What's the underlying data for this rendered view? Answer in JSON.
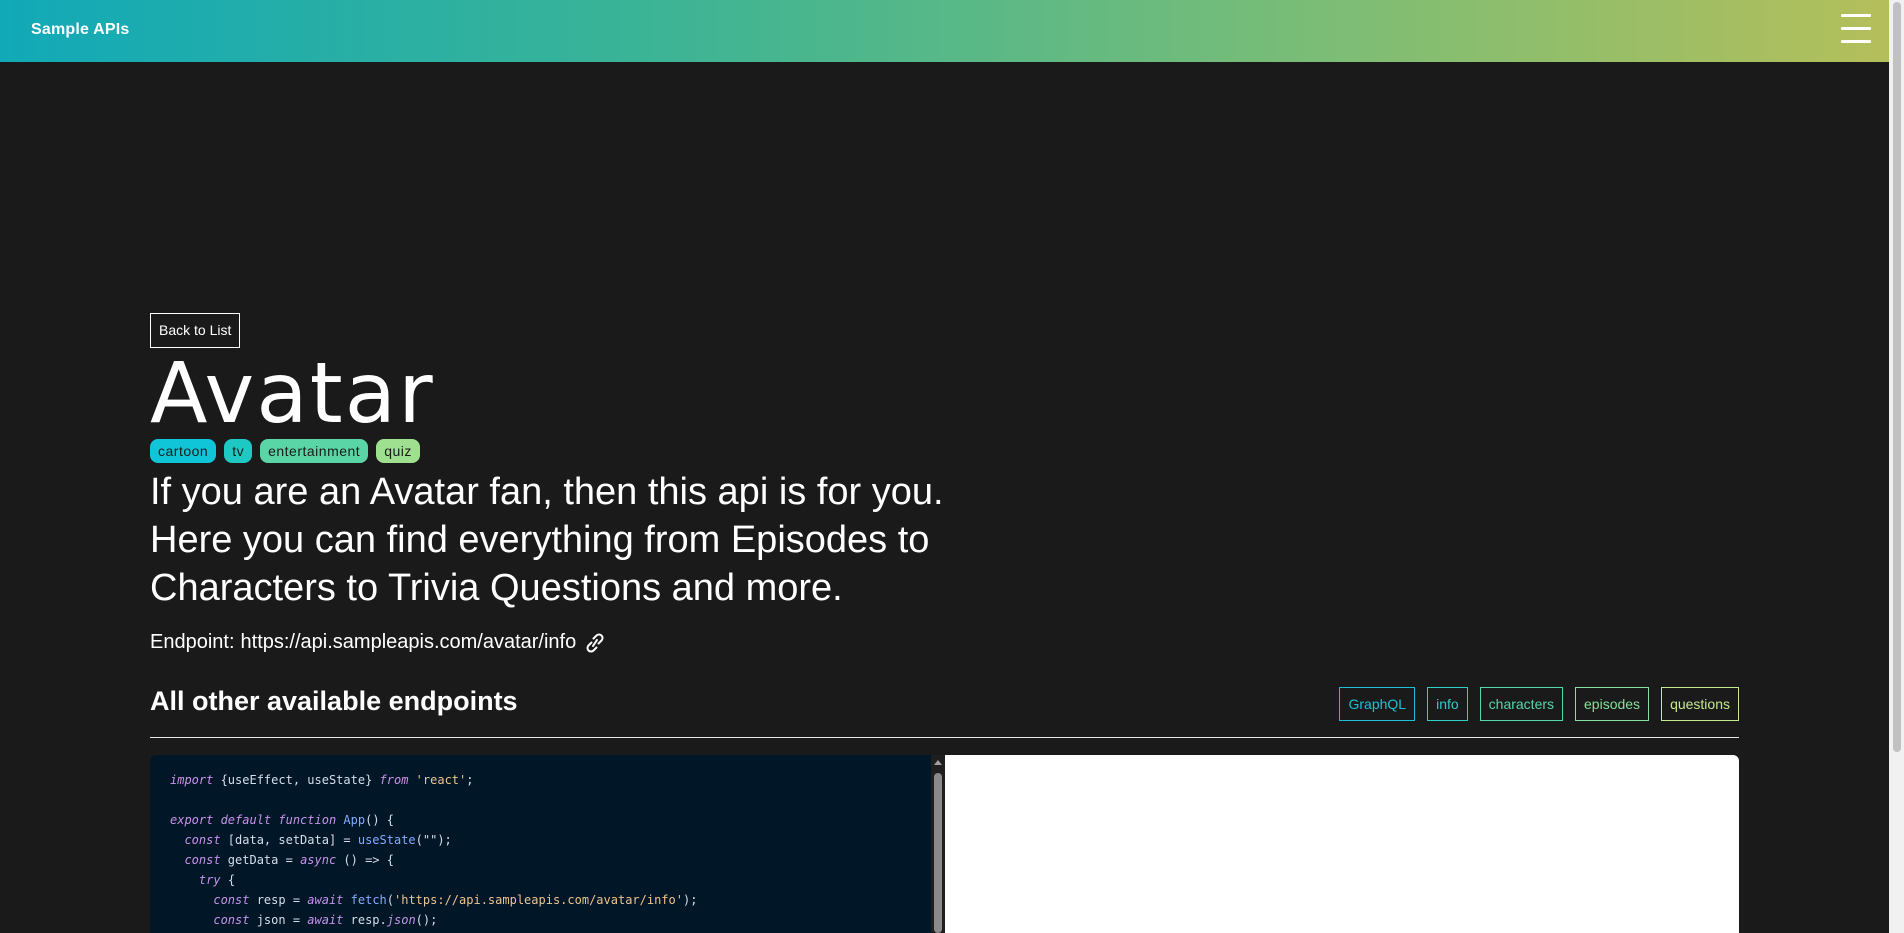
{
  "nav": {
    "brand": "Sample APIs",
    "menu_icon": "hamburger-menu-icon"
  },
  "back_button": "Back to List",
  "title": "Avatar",
  "tags": [
    {
      "label": "cartoon",
      "color": "#11c5d9"
    },
    {
      "label": "tv",
      "color": "#1fc9c3"
    },
    {
      "label": "entertainment",
      "color": "#5ad6a6"
    },
    {
      "label": "quiz",
      "color": "#9ee08f"
    }
  ],
  "description": "If you are an Avatar fan, then this api is for you. Here you can find everything from Episodes to Characters to Trivia Questions and more.",
  "endpoint": {
    "label": "Endpoint:",
    "url": "https://api.sampleapis.com/avatar/info",
    "icon": "link-icon"
  },
  "section_title": "All other available endpoints",
  "endpoint_links": [
    {
      "label": "GraphQL",
      "color": "#1ec0d6"
    },
    {
      "label": "info",
      "color": "#2fcfc8"
    },
    {
      "label": "characters",
      "color": "#52d8ab"
    },
    {
      "label": "episodes",
      "color": "#83e19b"
    },
    {
      "label": "questions",
      "color": "#c5ea8a"
    }
  ],
  "code": {
    "line1_kw_import": "import",
    "line1_a": " {useEffect, useState} ",
    "line1_kw_from": "from",
    "line1_str": "'react'",
    "line1_end": ";",
    "line3_kw": "export default function",
    "line3_fn": "App",
    "line3_end": "() {",
    "line4_kw": "const",
    "line4_a": " [data, setData] = ",
    "line4_fn": "useState",
    "line4_end": "(\"\");",
    "line5_kw": "const",
    "line5_a": " getData = ",
    "line5_kw2": "async",
    "line5_end": " () => {",
    "line6_kw": "try",
    "line6_end": " {",
    "line7_kw": "const",
    "line7_a": " resp = ",
    "line7_kw2": "await",
    "line7_fn": "fetch",
    "line7_str": "'https://api.sampleapis.com/avatar/info'",
    "line7_end": ");",
    "line8_kw": "const",
    "line8_a": " json = ",
    "line8_kw2": "await",
    "line8_b": " resp.",
    "line8_fn": "json",
    "line8_end": "();"
  },
  "colors": {
    "background": "#1a1a1a",
    "code_background": "#011627",
    "nav_gradient_start": "#11a9b8",
    "nav_gradient_end": "#b4bf5a"
  }
}
